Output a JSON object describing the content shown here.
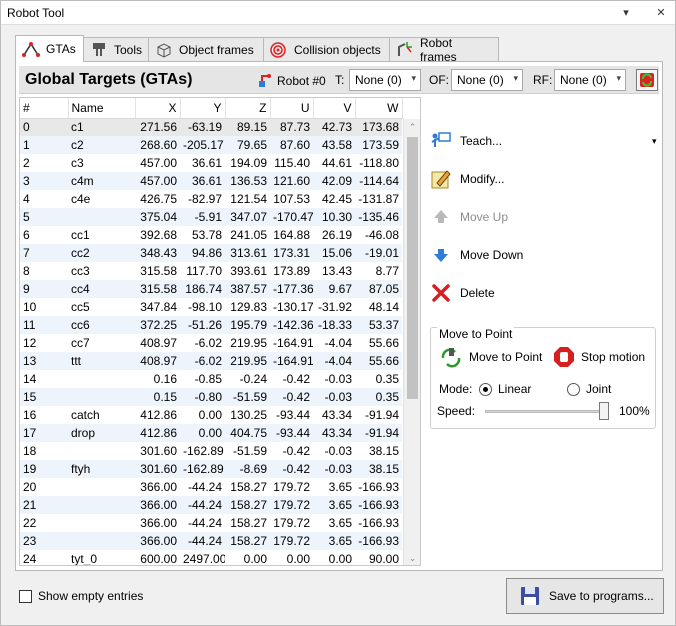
{
  "window": {
    "title": "Robot Tool",
    "pin_glyph": "▾",
    "close_glyph": "✕",
    "pin_icon": "pin-icon",
    "close_icon": "close-icon"
  },
  "tabs": [
    {
      "label": "GTAs",
      "icon": "gtas-icon",
      "active": true
    },
    {
      "label": "Tools",
      "icon": "tools-icon"
    },
    {
      "label": "Object frames",
      "icon": "object-frames-icon"
    },
    {
      "label": "Collision objects",
      "icon": "collision-objects-icon"
    },
    {
      "label": "Robot frames",
      "icon": "robot-frames-icon"
    }
  ],
  "header": {
    "title": "Global Targets (GTAs)",
    "robot": "Robot #0",
    "t_label": "T:",
    "t_value": "None (0)",
    "of_label": "OF:",
    "of_value": "None (0)",
    "rf_label": "RF:",
    "rf_value": "None (0)",
    "dropdown_glyph": "▾",
    "refresh_icon": "refresh-icon"
  },
  "table": {
    "columns": [
      "#",
      "Name",
      "X",
      "Y",
      "Z",
      "U",
      "V",
      "W"
    ],
    "rows": [
      [
        "0",
        "c1",
        "271.56",
        "-63.19",
        "89.15",
        "87.73",
        "42.73",
        "173.68"
      ],
      [
        "1",
        "c2",
        "268.60",
        "-205.17",
        "79.65",
        "87.60",
        "43.58",
        "173.59"
      ],
      [
        "2",
        "c3",
        "457.00",
        "36.61",
        "194.09",
        "115.40",
        "44.61",
        "-118.80"
      ],
      [
        "3",
        "c4m",
        "457.00",
        "36.61",
        "136.53",
        "121.60",
        "42.09",
        "-114.64"
      ],
      [
        "4",
        "c4e",
        "426.75",
        "-82.97",
        "121.54",
        "107.53",
        "42.45",
        "-131.87"
      ],
      [
        "5",
        "",
        "375.04",
        "-5.91",
        "347.07",
        "-170.47",
        "10.30",
        "-135.46"
      ],
      [
        "6",
        "cc1",
        "392.68",
        "53.78",
        "241.05",
        "164.88",
        "26.19",
        "-46.08"
      ],
      [
        "7",
        "cc2",
        "348.43",
        "94.86",
        "313.61",
        "173.31",
        "15.06",
        "-19.01"
      ],
      [
        "8",
        "cc3",
        "315.58",
        "117.70",
        "393.61",
        "173.89",
        "13.43",
        "8.77"
      ],
      [
        "9",
        "cc4",
        "315.58",
        "186.74",
        "387.57",
        "-177.36",
        "9.67",
        "87.05"
      ],
      [
        "10",
        "cc5",
        "347.84",
        "-98.10",
        "129.83",
        "-130.17",
        "-31.92",
        "48.14"
      ],
      [
        "11",
        "cc6",
        "372.25",
        "-51.26",
        "195.79",
        "-142.36",
        "-18.33",
        "53.37"
      ],
      [
        "12",
        "cc7",
        "408.97",
        "-6.02",
        "219.95",
        "-164.91",
        "-4.04",
        "55.66"
      ],
      [
        "13",
        "ttt",
        "408.97",
        "-6.02",
        "219.95",
        "-164.91",
        "-4.04",
        "55.66"
      ],
      [
        "14",
        "",
        "0.16",
        "-0.85",
        "-0.24",
        "-0.42",
        "-0.03",
        "0.35"
      ],
      [
        "15",
        "",
        "0.15",
        "-0.80",
        "-51.59",
        "-0.42",
        "-0.03",
        "0.35"
      ],
      [
        "16",
        "catch",
        "412.86",
        "0.00",
        "130.25",
        "-93.44",
        "43.34",
        "-91.94"
      ],
      [
        "17",
        "drop",
        "412.86",
        "0.00",
        "404.75",
        "-93.44",
        "43.34",
        "-91.94"
      ],
      [
        "18",
        "",
        "301.60",
        "-162.89",
        "-51.59",
        "-0.42",
        "-0.03",
        "38.15"
      ],
      [
        "19",
        "ftyh",
        "301.60",
        "-162.89",
        "-8.69",
        "-0.42",
        "-0.03",
        "38.15"
      ],
      [
        "20",
        "",
        "366.00",
        "-44.24",
        "158.27",
        "179.72",
        "3.65",
        "-166.93"
      ],
      [
        "21",
        "",
        "366.00",
        "-44.24",
        "158.27",
        "179.72",
        "3.65",
        "-166.93"
      ],
      [
        "22",
        "",
        "366.00",
        "-44.24",
        "158.27",
        "179.72",
        "3.65",
        "-166.93"
      ],
      [
        "23",
        "",
        "366.00",
        "-44.24",
        "158.27",
        "179.72",
        "3.65",
        "-166.93"
      ],
      [
        "24",
        "tyt_0",
        "600.00",
        "2497.00",
        "0.00",
        "0.00",
        "0.00",
        "90.00"
      ]
    ],
    "scroll_up_glyph": "⌃",
    "scroll_down_glyph": "⌄"
  },
  "actions": {
    "teach": "Teach...",
    "modify": "Modify...",
    "move_up": "Move Up",
    "move_down": "Move Down",
    "delete": "Delete",
    "teach_dropdown_glyph": "▾"
  },
  "move_to_point": {
    "caption": "Move to Point",
    "move_button": "Move to Point",
    "stop_button": "Stop motion",
    "mode_label": "Mode:",
    "mode_linear": "Linear",
    "mode_joint": "Joint",
    "mode_selected": "Linear",
    "speed_label": "Speed:",
    "speed_value": "100%",
    "speed_fraction": 1.0
  },
  "footer": {
    "show_empty": "Show empty entries",
    "show_empty_checked": false,
    "save_button": "Save to programs..."
  },
  "colors": {
    "row_alt": "#eef4fb",
    "header_bg": "#e5e5e5",
    "accent_blue": "#2f7bd8",
    "delete_red": "#d62020"
  }
}
